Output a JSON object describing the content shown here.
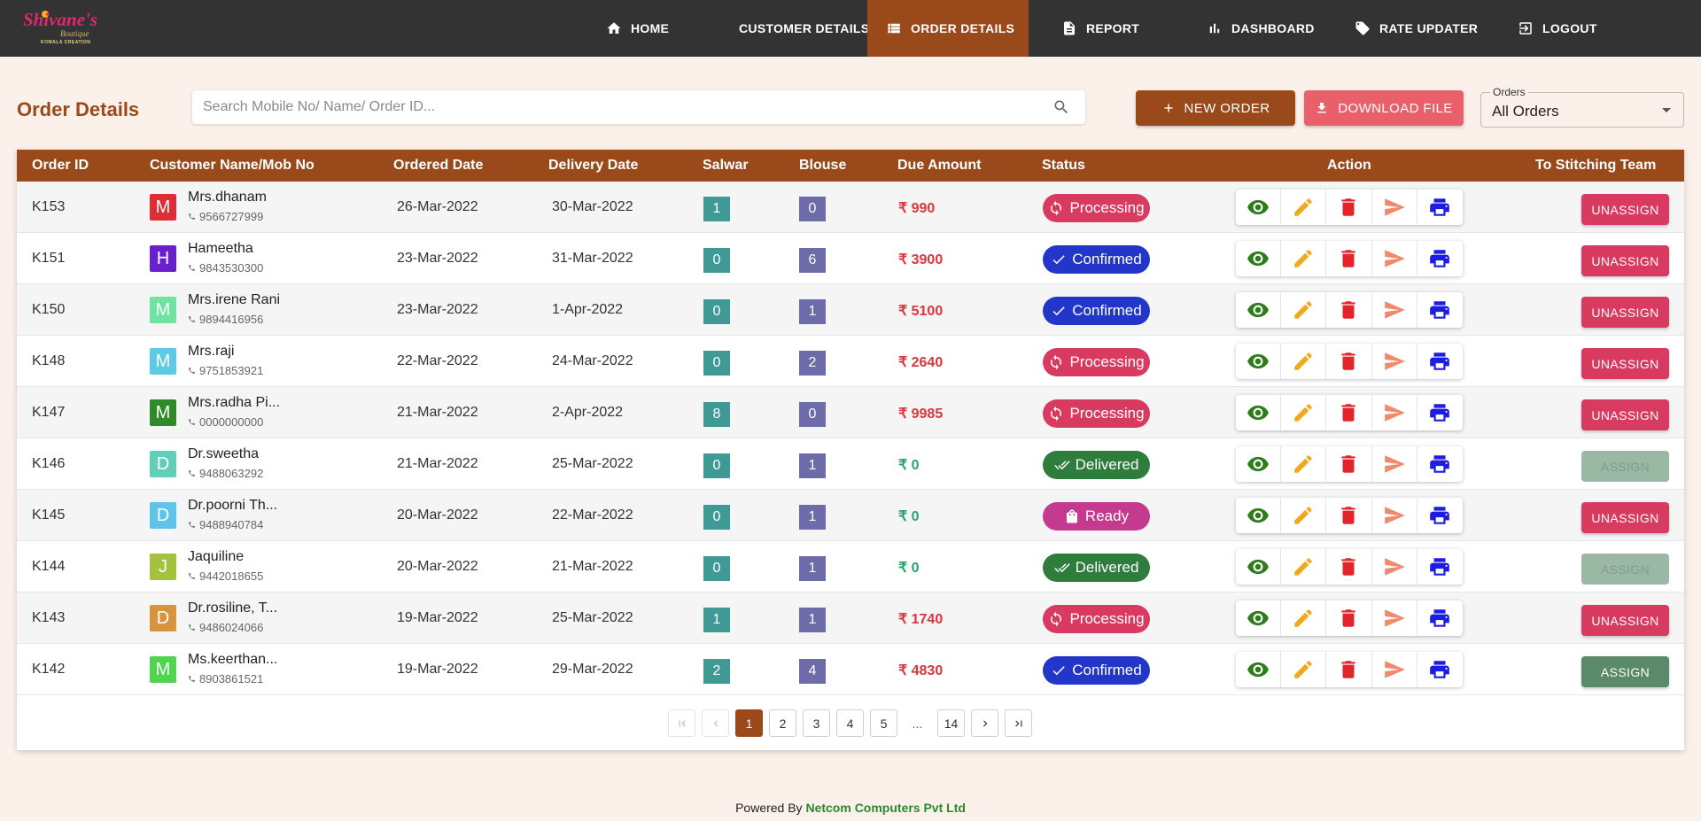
{
  "brand": {
    "name": "Shivane's",
    "sub": "Boutique",
    "tagline": "KOMALA CREATION"
  },
  "nav": [
    {
      "label": "HOME",
      "icon": "home-icon",
      "active": false
    },
    {
      "label": "CUSTOMER DETAILS",
      "icon": "people-icon",
      "active": false
    },
    {
      "label": "ORDER DETAILS",
      "icon": "list-icon",
      "active": true
    },
    {
      "label": "REPORT",
      "icon": "document-icon",
      "active": false
    },
    {
      "label": "DASHBOARD",
      "icon": "bar-chart-icon",
      "active": false
    },
    {
      "label": "RATE UPDATER",
      "icon": "tag-icon",
      "active": false
    },
    {
      "label": "LOGOUT",
      "icon": "logout-icon",
      "active": false
    }
  ],
  "page": {
    "title": "Order Details",
    "search_placeholder": "Search Mobile No/ Name/ Order ID...",
    "search_value": "",
    "new_order_label": "NEW ORDER",
    "download_label": "DOWNLOAD FILE",
    "filter_label": "Orders",
    "filter_value": "All Orders"
  },
  "colors": {
    "primary": "#9a4a1a",
    "danger": "#e95f6a",
    "due_positive": "#d9363e",
    "due_zero": "#2aa36b",
    "unassign": "#d93a5f",
    "assign": "#5a8a6a"
  },
  "table": {
    "headers": {
      "order_id": "Order ID",
      "customer": "Customer Name/Mob No",
      "ordered": "Ordered Date",
      "delivery": "Delivery Date",
      "salwar": "Salwar",
      "blouse": "Blouse",
      "due": "Due Amount",
      "status": "Status",
      "action": "Action",
      "stitching": "To Stitching Team"
    },
    "rows": [
      {
        "id": "K153",
        "initial": "M",
        "avatar_color": "#e02c35",
        "name": "Mrs.dhanam",
        "phone": "9566727999",
        "ordered": "26-Mar-2022",
        "delivery": "30-Mar-2022",
        "salwar": "1",
        "blouse": "0",
        "due": "₹ 990",
        "due_zero": false,
        "status": "Processing",
        "status_color": "#d93a5f",
        "status_icon": "sync-icon",
        "assign": "UNASSIGN"
      },
      {
        "id": "K151",
        "initial": "H",
        "avatar_color": "#6a1fd1",
        "name": "Hameetha",
        "phone": "9843530300",
        "ordered": "23-Mar-2022",
        "delivery": "31-Mar-2022",
        "salwar": "0",
        "blouse": "6",
        "due": "₹ 3900",
        "due_zero": false,
        "status": "Confirmed",
        "status_color": "#2236c9",
        "status_icon": "check-icon",
        "assign": "UNASSIGN"
      },
      {
        "id": "K150",
        "initial": "M",
        "avatar_color": "#6fe3a0",
        "name": "Mrs.irene Rani",
        "phone": "9894416956",
        "ordered": "23-Mar-2022",
        "delivery": "1-Apr-2022",
        "salwar": "0",
        "blouse": "1",
        "due": "₹ 5100",
        "due_zero": false,
        "status": "Confirmed",
        "status_color": "#2236c9",
        "status_icon": "check-icon",
        "assign": "UNASSIGN"
      },
      {
        "id": "K148",
        "initial": "M",
        "avatar_color": "#5ecbe6",
        "name": "Mrs.raji",
        "phone": "9751853921",
        "ordered": "22-Mar-2022",
        "delivery": "24-Mar-2022",
        "salwar": "0",
        "blouse": "2",
        "due": "₹ 2640",
        "due_zero": false,
        "status": "Processing",
        "status_color": "#d93a5f",
        "status_icon": "sync-icon",
        "assign": "UNASSIGN"
      },
      {
        "id": "K147",
        "initial": "M",
        "avatar_color": "#2f8a2a",
        "name": "Mrs.radha Pi...",
        "phone": "0000000000",
        "ordered": "21-Mar-2022",
        "delivery": "2-Apr-2022",
        "salwar": "8",
        "blouse": "0",
        "due": "₹ 9985",
        "due_zero": false,
        "status": "Processing",
        "status_color": "#d93a5f",
        "status_icon": "sync-icon",
        "assign": "UNASSIGN"
      },
      {
        "id": "K146",
        "initial": "D",
        "avatar_color": "#5fcfb8",
        "name": "Dr.sweetha",
        "phone": "9488063292",
        "ordered": "21-Mar-2022",
        "delivery": "25-Mar-2022",
        "salwar": "0",
        "blouse": "1",
        "due": "₹ 0",
        "due_zero": true,
        "status": "Delivered",
        "status_color": "#2e7d3c",
        "status_icon": "double-check-icon",
        "assign": "ASSIGN",
        "assign_dim": true
      },
      {
        "id": "K145",
        "initial": "D",
        "avatar_color": "#5ec4e8",
        "name": "Dr.poorni Th...",
        "phone": "9488940784",
        "ordered": "20-Mar-2022",
        "delivery": "22-Mar-2022",
        "salwar": "0",
        "blouse": "1",
        "due": "₹ 0",
        "due_zero": true,
        "status": "Ready",
        "status_color": "#c43a8f",
        "status_icon": "bag-icon",
        "assign": "UNASSIGN"
      },
      {
        "id": "K144",
        "initial": "J",
        "avatar_color": "#a4c23c",
        "name": "Jaquiline",
        "phone": "9442018655",
        "ordered": "20-Mar-2022",
        "delivery": "21-Mar-2022",
        "salwar": "0",
        "blouse": "1",
        "due": "₹ 0",
        "due_zero": true,
        "status": "Delivered",
        "status_color": "#2e7d3c",
        "status_icon": "double-check-icon",
        "assign": "ASSIGN",
        "assign_dim": true
      },
      {
        "id": "K143",
        "initial": "D",
        "avatar_color": "#d8943c",
        "name": "Dr.rosiline, T...",
        "phone": "9486024066",
        "ordered": "19-Mar-2022",
        "delivery": "25-Mar-2022",
        "salwar": "1",
        "blouse": "1",
        "due": "₹ 1740",
        "due_zero": false,
        "status": "Processing",
        "status_color": "#d93a5f",
        "status_icon": "sync-icon",
        "assign": "UNASSIGN"
      },
      {
        "id": "K142",
        "initial": "M",
        "avatar_color": "#4fd64f",
        "name": "Ms.keerthan...",
        "phone": "8903861521",
        "ordered": "19-Mar-2022",
        "delivery": "29-Mar-2022",
        "salwar": "2",
        "blouse": "4",
        "due": "₹ 4830",
        "due_zero": false,
        "status": "Confirmed",
        "status_color": "#2236c9",
        "status_icon": "check-icon",
        "assign": "ASSIGN"
      }
    ]
  },
  "pagination": {
    "pages": [
      "1",
      "2",
      "3",
      "4",
      "5",
      "...",
      "14"
    ],
    "current": "1"
  },
  "footer": {
    "prefix": "Powered By",
    "company": "Netcom Computers Pvt Ltd"
  }
}
